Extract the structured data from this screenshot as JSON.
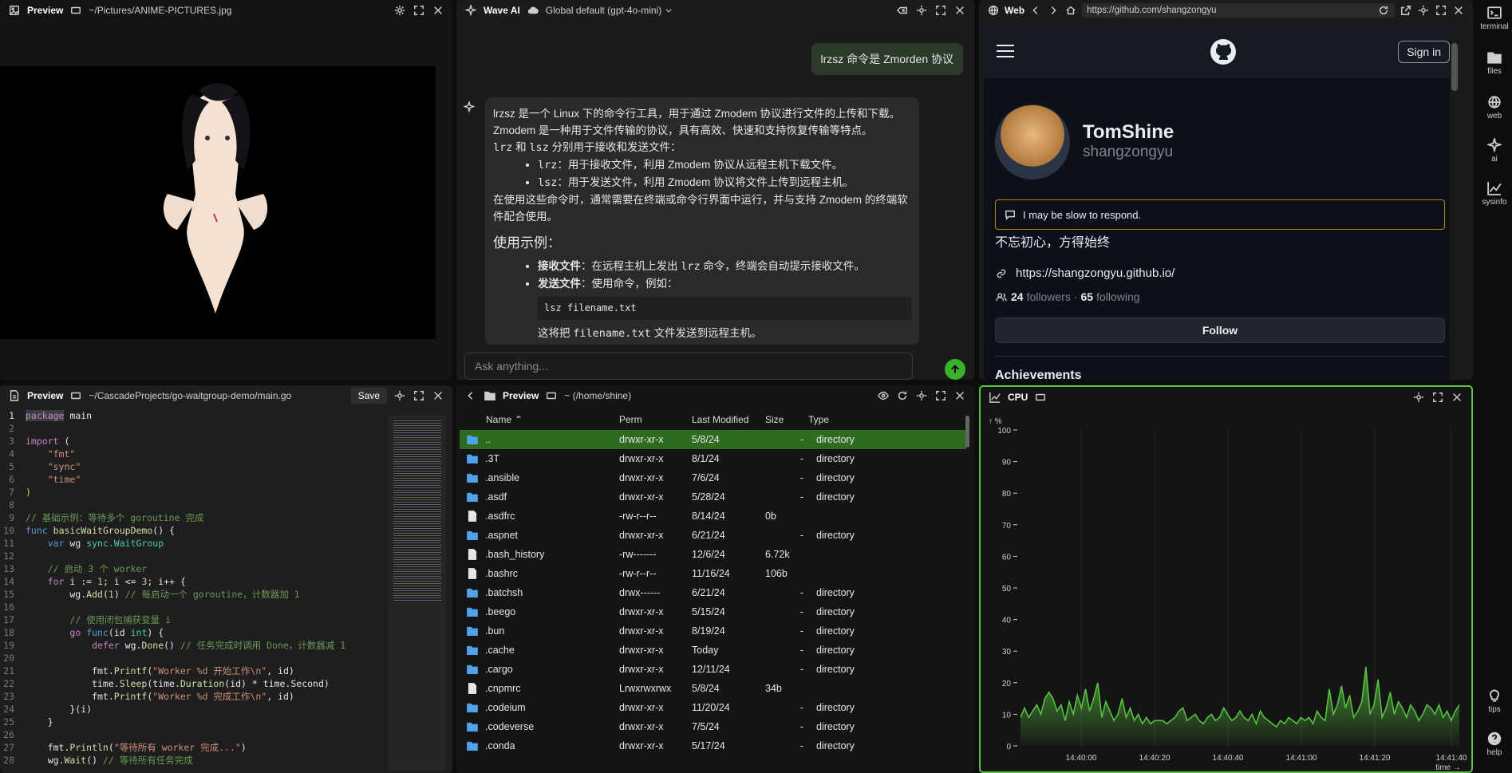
{
  "preview_image": {
    "title": "Preview",
    "path": "~/Pictures/ANIME-PICTURES.jpg"
  },
  "wave_ai": {
    "title": "Wave AI",
    "model": "Global default (gpt-4o-mini)",
    "user_message": "lrzsz 命令是 Zmorden 协议",
    "input_placeholder": "Ask anything...",
    "answer": {
      "p1": "lrzsz 是一个 Linux 下的命令行工具，用于通过 Zmodem 协议进行文件的上传和下载。Zmodem 是一种用于文件传输的协议，具有高效、快速和支持恢复传输等特点。",
      "p2_code1": "lrz",
      "p2_mid": " 和 ",
      "p2_code2": "lsz",
      "p2_rest": " 分别用于接收和发送文件：",
      "li1_code": "lrz",
      "li1_text": "：用于接收文件，利用 Zmodem 协议从远程主机下载文件。",
      "li2_code": "lsz",
      "li2_text": "：用于发送文件，利用 Zmodem 协议将文件上传到远程主机。",
      "p3": "在使用这些命令时，通常需要在终端或命令行界面中运行，并与支持 Zmodem 的终端软件配合使用。",
      "h": "使用示例：",
      "ex1_b": "接收文件",
      "ex1_a": "：在远程主机上发出 ",
      "ex1_code": "lrz",
      "ex1_c": " 命令，终端会自动提示接收文件。",
      "ex2_b": "发送文件",
      "ex2_a": "：使用命令，例如：",
      "codeblock": "lsz filename.txt",
      "p4_a": "这将把 ",
      "p4_code": "filename.txt",
      "p4_b": " 文件发送到远程主机。"
    }
  },
  "web": {
    "title": "Web",
    "url": "https://github.com/shangzongyu",
    "sign_in": "Sign in",
    "name": "TomShine",
    "login": "shangzongyu",
    "status": "I may be slow to respond.",
    "bio": "不忘初心，方得始终",
    "link": "https://shangzongyu.github.io/",
    "followers": "24",
    "followers_label": "followers",
    "sep": " · ",
    "following": "65",
    "following_label": "following",
    "follow": "Follow",
    "achievements": "Achievements"
  },
  "sidebar": {
    "items": [
      {
        "label": "terminal"
      },
      {
        "label": "files"
      },
      {
        "label": "web"
      },
      {
        "label": "ai"
      },
      {
        "label": "sysinfo"
      }
    ],
    "tips": "tips",
    "help": "help"
  },
  "editor": {
    "title": "Preview",
    "path": "~/CascadeProjects/go-waitgroup-demo/main.go",
    "save": "Save"
  },
  "files": {
    "title": "Preview",
    "path": "~ (/home/shine)",
    "columns": [
      "Name",
      "Perm",
      "Last Modified",
      "Size",
      "Type"
    ],
    "rows": [
      {
        "name": "..",
        "perm": "drwxr-xr-x",
        "mod": "5/8/24",
        "size": "-",
        "type": "directory",
        "dir": true
      },
      {
        "name": ".3T",
        "perm": "drwxr-xr-x",
        "mod": "8/1/24",
        "size": "-",
        "type": "directory",
        "dir": true
      },
      {
        "name": ".ansible",
        "perm": "drwxr-xr-x",
        "mod": "7/6/24",
        "size": "-",
        "type": "directory",
        "dir": true
      },
      {
        "name": ".asdf",
        "perm": "drwxr-xr-x",
        "mod": "5/28/24",
        "size": "-",
        "type": "directory",
        "dir": true
      },
      {
        "name": ".asdfrc",
        "perm": "-rw-r--r--",
        "mod": "8/14/24",
        "size": "0b",
        "type": "",
        "dir": false
      },
      {
        "name": ".aspnet",
        "perm": "drwxr-xr-x",
        "mod": "6/21/24",
        "size": "-",
        "type": "directory",
        "dir": true
      },
      {
        "name": ".bash_history",
        "perm": "-rw-------",
        "mod": "12/6/24",
        "size": "6.72k",
        "type": "",
        "dir": false
      },
      {
        "name": ".bashrc",
        "perm": "-rw-r--r--",
        "mod": "11/16/24",
        "size": "106b",
        "type": "",
        "dir": false
      },
      {
        "name": ".batchsh",
        "perm": "drwx------",
        "mod": "6/21/24",
        "size": "-",
        "type": "directory",
        "dir": true
      },
      {
        "name": ".beego",
        "perm": "drwxr-xr-x",
        "mod": "5/15/24",
        "size": "-",
        "type": "directory",
        "dir": true
      },
      {
        "name": ".bun",
        "perm": "drwxr-xr-x",
        "mod": "8/19/24",
        "size": "-",
        "type": "directory",
        "dir": true
      },
      {
        "name": ".cache",
        "perm": "drwxr-xr-x",
        "mod": "Today",
        "size": "-",
        "type": "directory",
        "dir": true
      },
      {
        "name": ".cargo",
        "perm": "drwxr-xr-x",
        "mod": "12/11/24",
        "size": "-",
        "type": "directory",
        "dir": true
      },
      {
        "name": ".cnpmrc",
        "perm": "Lrwxrwxrwx",
        "mod": "5/8/24",
        "size": "34b",
        "type": "",
        "dir": false
      },
      {
        "name": ".codeium",
        "perm": "drwxr-xr-x",
        "mod": "11/20/24",
        "size": "-",
        "type": "directory",
        "dir": true
      },
      {
        "name": ".codeverse",
        "perm": "drwxr-xr-x",
        "mod": "7/5/24",
        "size": "-",
        "type": "directory",
        "dir": true
      },
      {
        "name": ".conda",
        "perm": "drwxr-xr-x",
        "mod": "5/17/24",
        "size": "-",
        "type": "directory",
        "dir": true
      }
    ]
  },
  "cpu": {
    "title": "CPU",
    "accent": "#58c142"
  },
  "chart_data": {
    "type": "area",
    "title": "CPU",
    "ylabel": "%",
    "xlabel": "time →",
    "ylim": [
      0,
      100
    ],
    "yticks": [
      "0",
      "10",
      "20",
      "30",
      "40",
      "50",
      "60",
      "70",
      "80",
      "90",
      "100"
    ],
    "xticks": [
      "14:40:00",
      "14:40:20",
      "14:40:40",
      "14:41:00",
      "14:41:20",
      "14:41:40"
    ],
    "series": [
      {
        "values": [
          9,
          12,
          9,
          11,
          13,
          10,
          15,
          17,
          15,
          11,
          13,
          8,
          14,
          10,
          16,
          12,
          18,
          11,
          15,
          20,
          9,
          14,
          11,
          8,
          10,
          15,
          9,
          12,
          8,
          10,
          7,
          9,
          7,
          8,
          8,
          8,
          7,
          8,
          9,
          11,
          12,
          8,
          9,
          10,
          8,
          7,
          9,
          10,
          8,
          9,
          12,
          10,
          8,
          9,
          11,
          9,
          8,
          10,
          7,
          11,
          9,
          8,
          7,
          6,
          8,
          7,
          9,
          8,
          7,
          9,
          8,
          9,
          7,
          11,
          9,
          8,
          18,
          10,
          13,
          19,
          12,
          16,
          9,
          11,
          14,
          25,
          10,
          13,
          21,
          9,
          12,
          17,
          10,
          14,
          12,
          9,
          13,
          11,
          8,
          10,
          13,
          12,
          10,
          13,
          9,
          11,
          8,
          11,
          13
        ]
      }
    ]
  }
}
